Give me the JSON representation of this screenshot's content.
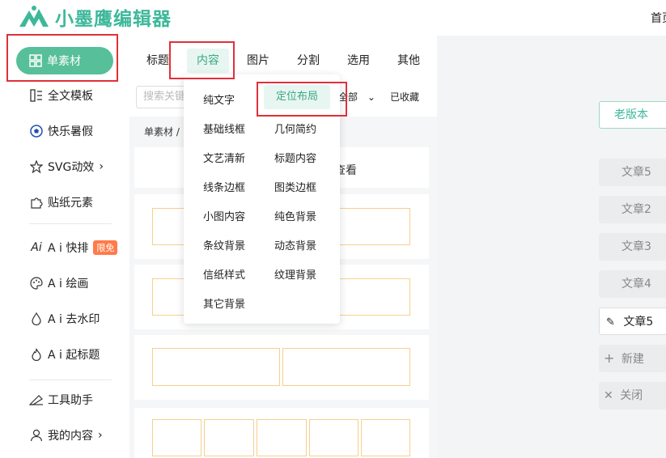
{
  "header": {
    "logo_text": "小墨鹰编辑器",
    "home_link": "首页"
  },
  "sidebar": {
    "items": [
      {
        "label": "单素材",
        "icon": "grid-icon"
      },
      {
        "label": "全文模板",
        "icon": "template-icon"
      },
      {
        "label": "快乐暑假",
        "icon": "soccer-ball-icon"
      },
      {
        "label": "SVG动效",
        "icon": "star-outline-icon"
      },
      {
        "label": "贴纸元素",
        "icon": "puzzle-icon"
      },
      {
        "label": "A i 快排",
        "icon": "ai-icon",
        "badge": "限免"
      },
      {
        "label": "A i 绘画",
        "icon": "palette-icon"
      },
      {
        "label": "A i 去水印",
        "icon": "droplet-icon"
      },
      {
        "label": "A i 起标题",
        "icon": "flame-icon"
      },
      {
        "label": "工具助手",
        "icon": "ruler-icon"
      },
      {
        "label": "我的内容",
        "icon": "user-icon"
      }
    ]
  },
  "tabs": [
    "标题",
    "内容",
    "图片",
    "分割",
    "选用",
    "其他"
  ],
  "filter": {
    "search_placeholder": "搜索关键",
    "select_value": "全部",
    "favorites": "已收藏"
  },
  "breadcrumb": "单素材 /",
  "hint_text": "查看",
  "dropdown": {
    "left": [
      "纯文字",
      "基础线框",
      "文艺清新",
      "线条边框",
      "小图内容",
      "条纹背景",
      "信纸样式",
      "其它背景"
    ],
    "right": [
      "定位布局",
      "几何简约",
      "标题内容",
      "图类边框",
      "纯色背景",
      "动态背景",
      "纹理背景"
    ]
  },
  "right_panel": {
    "old_version": "老版本",
    "articles": [
      "文章5",
      "文章2",
      "文章3",
      "文章4",
      "文章5"
    ],
    "new_label": "新建",
    "close_label": "关闭"
  },
  "colors": {
    "accent": "#57bf9a",
    "highlight": "#e0303a",
    "frame": "#f6d08f"
  }
}
